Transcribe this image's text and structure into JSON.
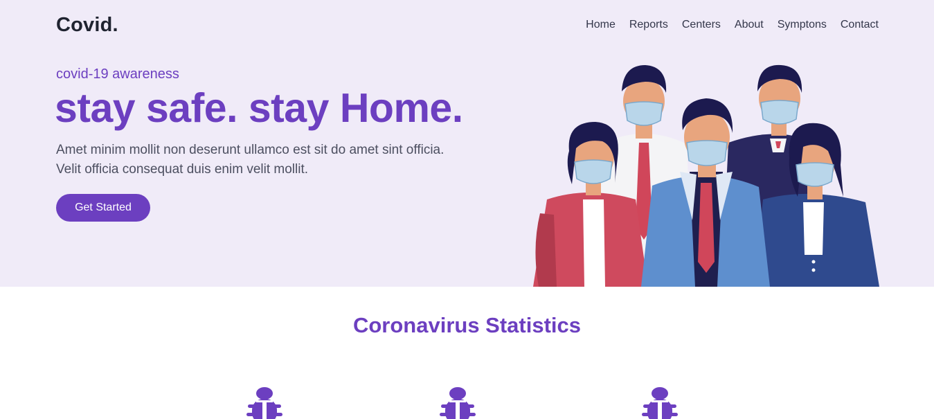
{
  "brand": {
    "logo": "Covid."
  },
  "nav": {
    "items": [
      {
        "label": "Home"
      },
      {
        "label": "Reports"
      },
      {
        "label": "Centers"
      },
      {
        "label": "About"
      },
      {
        "label": "Symptons"
      },
      {
        "label": "Contact"
      }
    ]
  },
  "hero": {
    "eyebrow": "covid-19 awareness",
    "headline": "stay safe. stay Home.",
    "description_line1": "Amet minim mollit non deserunt ullamco est sit do amet sint officia.",
    "description_line2": "Velit officia consequat duis enim velit mollit.",
    "cta_label": "Get Started",
    "illustration": "masked-people-illustration"
  },
  "stats": {
    "title": "Coronavirus Statistics",
    "icons": [
      "bug-icon",
      "bug-icon",
      "bug-icon"
    ]
  },
  "colors": {
    "accent": "#6c3fc0",
    "hero_background": "#f0ebf8",
    "text_dark": "#1f2330",
    "text_body": "#4c4f60"
  }
}
